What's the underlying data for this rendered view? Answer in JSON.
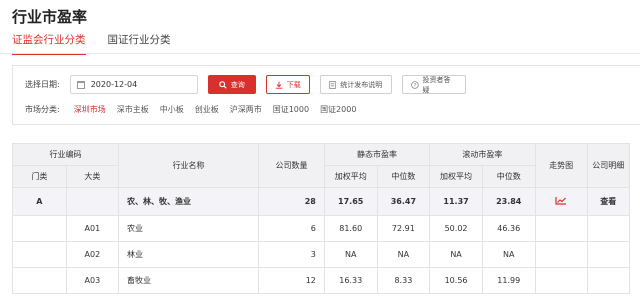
{
  "page": {
    "title": "行业市盈率"
  },
  "tabs": [
    {
      "label": "证监会行业分类",
      "active": true
    },
    {
      "label": "国证行业分类",
      "active": false
    }
  ],
  "filters": {
    "date_label": "选择日期:",
    "date_value": "2020-12-04",
    "query_label": "查询",
    "download_label": "下载",
    "publish_note_label": "统计发布说明",
    "investor_guide_label": "投资者答疑",
    "market_label": "市场分类:",
    "markets": [
      "深圳市场",
      "深市主板",
      "中小板",
      "创业板",
      "沪深两市",
      "国证1000",
      "国证2000"
    ],
    "active_market": "深圳市场"
  },
  "table": {
    "headers": {
      "industry_code": "行业编码",
      "category": "门类",
      "subcategory": "大类",
      "industry_name": "行业名称",
      "company_count": "公司数量",
      "static_pe": "静态市盈率",
      "rolling_pe": "滚动市盈率",
      "weighted_avg": "加权平均",
      "median": "中位数",
      "trend": "走势图",
      "company_detail": "公司明细"
    },
    "rows": [
      {
        "category": "A",
        "subcategory": "",
        "name": "农、林、牧、渔业",
        "count": "28",
        "static_weighted": "17.65",
        "static_median": "36.47",
        "rolling_weighted": "11.37",
        "rolling_median": "23.84",
        "detail": "查看",
        "summary": true
      },
      {
        "category": "",
        "subcategory": "A01",
        "name": "农业",
        "count": "6",
        "static_weighted": "81.60",
        "static_median": "72.91",
        "rolling_weighted": "50.02",
        "rolling_median": "46.36",
        "detail": "",
        "summary": false
      },
      {
        "category": "",
        "subcategory": "A02",
        "name": "林业",
        "count": "3",
        "static_weighted": "NA",
        "static_median": "NA",
        "rolling_weighted": "NA",
        "rolling_median": "NA",
        "detail": "",
        "summary": false
      },
      {
        "category": "",
        "subcategory": "A03",
        "name": "畜牧业",
        "count": "12",
        "static_weighted": "16.33",
        "static_median": "8.33",
        "rolling_weighted": "10.56",
        "rolling_median": "11.99",
        "detail": "",
        "summary": false
      }
    ]
  },
  "colors": {
    "accent": "#d8302d",
    "header_bg": "#f1f1f3"
  },
  "icons": {
    "calendar": "calendar-icon",
    "search": "search-icon",
    "download": "download-icon",
    "document": "document-icon",
    "help": "help-icon",
    "trend": "line-chart-icon"
  }
}
